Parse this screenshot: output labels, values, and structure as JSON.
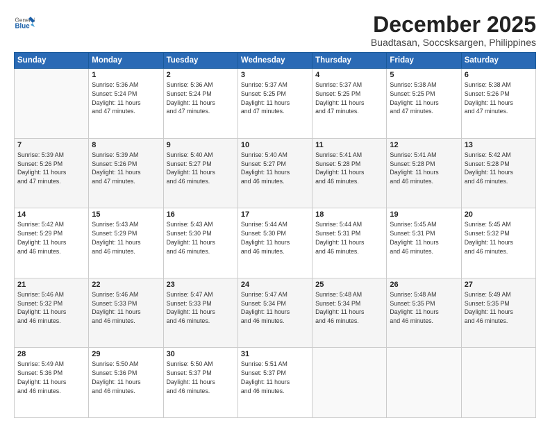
{
  "header": {
    "logo_general": "General",
    "logo_blue": "Blue",
    "title": "December 2025",
    "subtitle": "Buadtasan, Soccsksargen, Philippines"
  },
  "columns": [
    "Sunday",
    "Monday",
    "Tuesday",
    "Wednesday",
    "Thursday",
    "Friday",
    "Saturday"
  ],
  "weeks": [
    [
      {
        "day": "",
        "info": ""
      },
      {
        "day": "1",
        "info": "Sunrise: 5:36 AM\nSunset: 5:24 PM\nDaylight: 11 hours\nand 47 minutes."
      },
      {
        "day": "2",
        "info": "Sunrise: 5:36 AM\nSunset: 5:24 PM\nDaylight: 11 hours\nand 47 minutes."
      },
      {
        "day": "3",
        "info": "Sunrise: 5:37 AM\nSunset: 5:25 PM\nDaylight: 11 hours\nand 47 minutes."
      },
      {
        "day": "4",
        "info": "Sunrise: 5:37 AM\nSunset: 5:25 PM\nDaylight: 11 hours\nand 47 minutes."
      },
      {
        "day": "5",
        "info": "Sunrise: 5:38 AM\nSunset: 5:25 PM\nDaylight: 11 hours\nand 47 minutes."
      },
      {
        "day": "6",
        "info": "Sunrise: 5:38 AM\nSunset: 5:26 PM\nDaylight: 11 hours\nand 47 minutes."
      }
    ],
    [
      {
        "day": "7",
        "info": "Sunrise: 5:39 AM\nSunset: 5:26 PM\nDaylight: 11 hours\nand 47 minutes."
      },
      {
        "day": "8",
        "info": "Sunrise: 5:39 AM\nSunset: 5:26 PM\nDaylight: 11 hours\nand 47 minutes."
      },
      {
        "day": "9",
        "info": "Sunrise: 5:40 AM\nSunset: 5:27 PM\nDaylight: 11 hours\nand 46 minutes."
      },
      {
        "day": "10",
        "info": "Sunrise: 5:40 AM\nSunset: 5:27 PM\nDaylight: 11 hours\nand 46 minutes."
      },
      {
        "day": "11",
        "info": "Sunrise: 5:41 AM\nSunset: 5:28 PM\nDaylight: 11 hours\nand 46 minutes."
      },
      {
        "day": "12",
        "info": "Sunrise: 5:41 AM\nSunset: 5:28 PM\nDaylight: 11 hours\nand 46 minutes."
      },
      {
        "day": "13",
        "info": "Sunrise: 5:42 AM\nSunset: 5:28 PM\nDaylight: 11 hours\nand 46 minutes."
      }
    ],
    [
      {
        "day": "14",
        "info": "Sunrise: 5:42 AM\nSunset: 5:29 PM\nDaylight: 11 hours\nand 46 minutes."
      },
      {
        "day": "15",
        "info": "Sunrise: 5:43 AM\nSunset: 5:29 PM\nDaylight: 11 hours\nand 46 minutes."
      },
      {
        "day": "16",
        "info": "Sunrise: 5:43 AM\nSunset: 5:30 PM\nDaylight: 11 hours\nand 46 minutes."
      },
      {
        "day": "17",
        "info": "Sunrise: 5:44 AM\nSunset: 5:30 PM\nDaylight: 11 hours\nand 46 minutes."
      },
      {
        "day": "18",
        "info": "Sunrise: 5:44 AM\nSunset: 5:31 PM\nDaylight: 11 hours\nand 46 minutes."
      },
      {
        "day": "19",
        "info": "Sunrise: 5:45 AM\nSunset: 5:31 PM\nDaylight: 11 hours\nand 46 minutes."
      },
      {
        "day": "20",
        "info": "Sunrise: 5:45 AM\nSunset: 5:32 PM\nDaylight: 11 hours\nand 46 minutes."
      }
    ],
    [
      {
        "day": "21",
        "info": "Sunrise: 5:46 AM\nSunset: 5:32 PM\nDaylight: 11 hours\nand 46 minutes."
      },
      {
        "day": "22",
        "info": "Sunrise: 5:46 AM\nSunset: 5:33 PM\nDaylight: 11 hours\nand 46 minutes."
      },
      {
        "day": "23",
        "info": "Sunrise: 5:47 AM\nSunset: 5:33 PM\nDaylight: 11 hours\nand 46 minutes."
      },
      {
        "day": "24",
        "info": "Sunrise: 5:47 AM\nSunset: 5:34 PM\nDaylight: 11 hours\nand 46 minutes."
      },
      {
        "day": "25",
        "info": "Sunrise: 5:48 AM\nSunset: 5:34 PM\nDaylight: 11 hours\nand 46 minutes."
      },
      {
        "day": "26",
        "info": "Sunrise: 5:48 AM\nSunset: 5:35 PM\nDaylight: 11 hours\nand 46 minutes."
      },
      {
        "day": "27",
        "info": "Sunrise: 5:49 AM\nSunset: 5:35 PM\nDaylight: 11 hours\nand 46 minutes."
      }
    ],
    [
      {
        "day": "28",
        "info": "Sunrise: 5:49 AM\nSunset: 5:36 PM\nDaylight: 11 hours\nand 46 minutes."
      },
      {
        "day": "29",
        "info": "Sunrise: 5:50 AM\nSunset: 5:36 PM\nDaylight: 11 hours\nand 46 minutes."
      },
      {
        "day": "30",
        "info": "Sunrise: 5:50 AM\nSunset: 5:37 PM\nDaylight: 11 hours\nand 46 minutes."
      },
      {
        "day": "31",
        "info": "Sunrise: 5:51 AM\nSunset: 5:37 PM\nDaylight: 11 hours\nand 46 minutes."
      },
      {
        "day": "",
        "info": ""
      },
      {
        "day": "",
        "info": ""
      },
      {
        "day": "",
        "info": ""
      }
    ]
  ]
}
